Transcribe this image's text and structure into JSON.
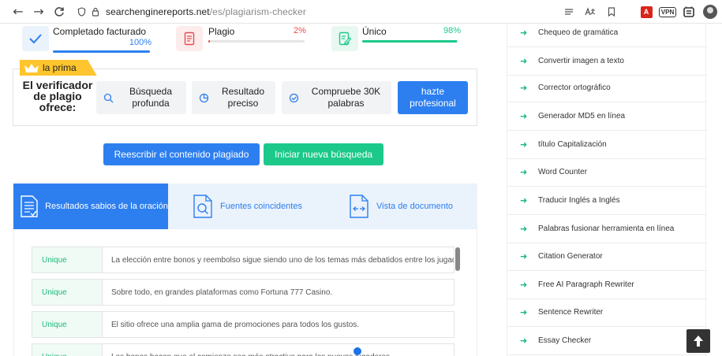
{
  "browser": {
    "back_icon": "arrow-left-icon",
    "forward_icon": "arrow-right-icon",
    "reload_icon": "reload-icon",
    "url_domain": "searchenginereports.net",
    "url_path": "/es/plagiarism-checker"
  },
  "stats": [
    {
      "label": "Completado facturado",
      "value": "100%",
      "progress": 1.0,
      "color": "#2d7ff0"
    },
    {
      "label": "Plagio",
      "value": "2%",
      "progress": 0.02,
      "color": "#e84c4c"
    },
    {
      "label": "Único",
      "value": "98%",
      "progress": 0.98,
      "color": "#1cc98a"
    }
  ],
  "premium": {
    "tag": "la prima",
    "title": "El verificador de plagio ofrece:",
    "features": [
      "Búsqueda profunda",
      "Resultado preciso",
      "Compruebe 30K palabras"
    ],
    "pro_button": "hazte profesional"
  },
  "actions": {
    "rewrite": "Reescribir el contenido plagiado",
    "new_search": "Iniciar nueva búsqueda"
  },
  "tabs": [
    {
      "label": "Resultados sabios de la oración",
      "active": true
    },
    {
      "label": "Fuentes coincidentes",
      "active": false
    },
    {
      "label": "Vista de documento",
      "active": false
    }
  ],
  "results": [
    {
      "badge": "Unique",
      "text": "La elección entre bonos y reembolso sigue siendo uno de los temas más debatidos entre los jugadores."
    },
    {
      "badge": "Unique",
      "text": "Sobre todo, en grandes plataformas como Fortuna 777 Casino."
    },
    {
      "badge": "Unique",
      "text": "El sitio ofrece una amplia gama de promociones para todos los gustos."
    },
    {
      "badge": "Unique",
      "text": "Los bonos hacen que el comienzo sea más atractivo para los nuevos jugadores."
    }
  ],
  "sidebar": [
    "Chequeo de gramática",
    "Convertir imagen a texto",
    "Corrector ortográfico",
    "Generador MD5 en línea",
    "título Capitalización",
    "Word Counter",
    "Traducir Inglés a Inglés",
    "Palabras fusionar herramienta en línea",
    "Citation Generator",
    "Free AI Paragraph Rewriter",
    "Sentence Rewriter",
    "Essay Checker"
  ],
  "toolbar": {
    "vpn_label": "VPN",
    "pdf_label": "A"
  }
}
